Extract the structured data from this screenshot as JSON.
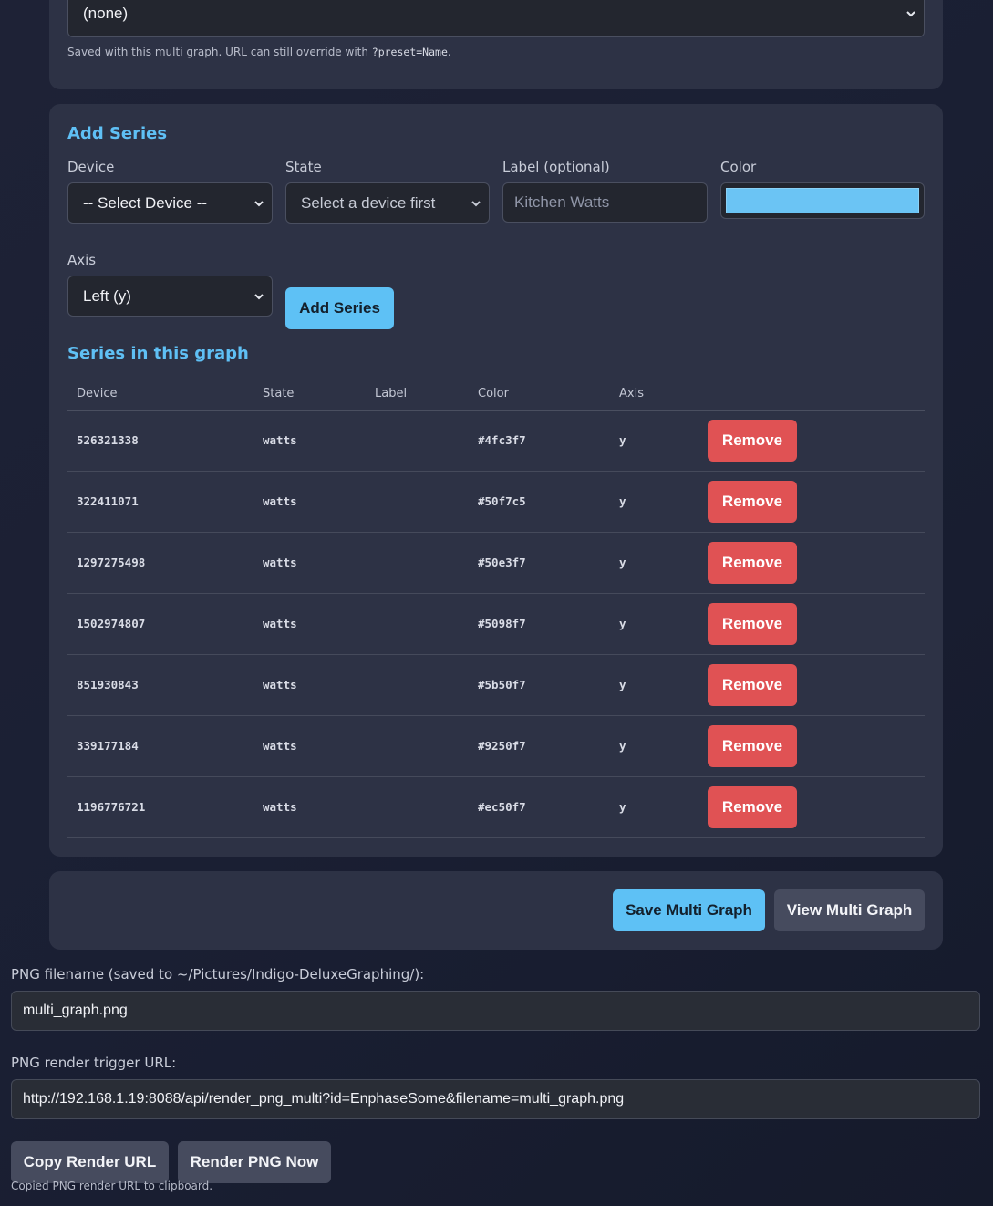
{
  "preset": {
    "selected": "(none)",
    "hint_prefix": "Saved with this multi graph. URL can still override with ",
    "hint_code": "?preset=Name",
    "hint_suffix": "."
  },
  "add_series": {
    "title": "Add Series",
    "device_label": "Device",
    "device_value": "-- Select Device --",
    "state_label": "State",
    "state_value": "Select a device first",
    "label_label": "Label (optional)",
    "label_placeholder": "Kitchen Watts",
    "color_label": "Color",
    "color_value": "#6bc4f4",
    "axis_label": "Axis",
    "axis_value": "Left (y)",
    "add_button": "Add Series"
  },
  "series_table": {
    "title": "Series in this graph",
    "headers": [
      "Device",
      "State",
      "Label",
      "Color",
      "Axis",
      ""
    ],
    "remove_label": "Remove",
    "rows": [
      {
        "device": "526321338",
        "state": "watts",
        "label": "",
        "color": "#4fc3f7",
        "axis": "y"
      },
      {
        "device": "322411071",
        "state": "watts",
        "label": "",
        "color": "#50f7c5",
        "axis": "y"
      },
      {
        "device": "1297275498",
        "state": "watts",
        "label": "",
        "color": "#50e3f7",
        "axis": "y"
      },
      {
        "device": "1502974807",
        "state": "watts",
        "label": "",
        "color": "#5098f7",
        "axis": "y"
      },
      {
        "device": "851930843",
        "state": "watts",
        "label": "",
        "color": "#5b50f7",
        "axis": "y"
      },
      {
        "device": "339177184",
        "state": "watts",
        "label": "",
        "color": "#9250f7",
        "axis": "y"
      },
      {
        "device": "1196776721",
        "state": "watts",
        "label": "",
        "color": "#ec50f7",
        "axis": "y"
      }
    ]
  },
  "actions": {
    "save": "Save Multi Graph",
    "view": "View Multi Graph"
  },
  "png": {
    "filename_label": "PNG filename (saved to ~/Pictures/Indigo-DeluxeGraphing/):",
    "filename_value": "multi_graph.png",
    "url_label": "PNG render trigger URL:",
    "url_value": "http://192.168.1.19:8088/api/render_png_multi?id=EnphaseSome&filename=multi_graph.png",
    "copy_button": "Copy Render URL",
    "render_button": "Render PNG Now",
    "status": "Copied PNG render URL to clipboard."
  },
  "colors": {
    "accent": "#5ec1f5",
    "danger": "#e05254",
    "card": "#2d3245"
  }
}
